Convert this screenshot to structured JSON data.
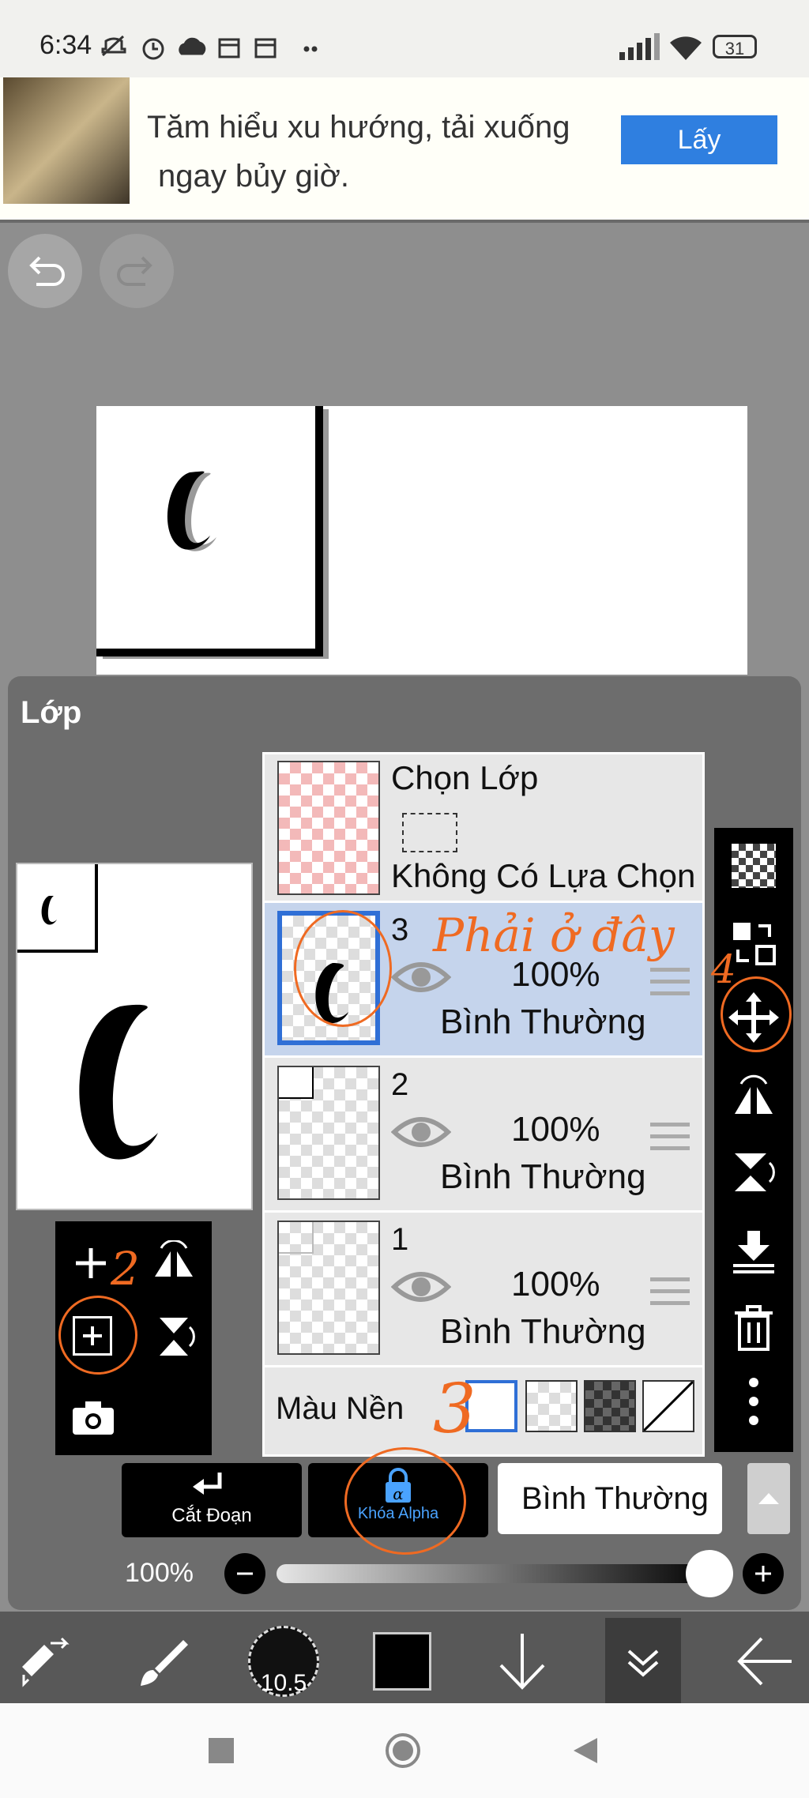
{
  "status_bar": {
    "time": "6:34",
    "battery": "31"
  },
  "ad": {
    "text_line1": "Tăm hiểu xu hướng, tải xuống",
    "text_line2": "ngay bủy giờ.",
    "button_label": "Lấy"
  },
  "layer_panel": {
    "title": "Lớp",
    "selection_layer": {
      "title": "Chọn Lớp",
      "status": "Không Có Lựa Chọn"
    },
    "layers": [
      {
        "number": "3",
        "opacity": "100%",
        "blend_mode": "Bình Thường",
        "selected": true
      },
      {
        "number": "2",
        "opacity": "100%",
        "blend_mode": "Bình Thường",
        "selected": false
      },
      {
        "number": "1",
        "opacity": "100%",
        "blend_mode": "Bình Thường",
        "selected": false
      }
    ],
    "background_label": "Màu Nền"
  },
  "bottom_controls": {
    "clip_label": "Cắt Đoạn",
    "alpha_lock_label": "Khóa Alpha",
    "blend_mode_value": "Bình Thường",
    "opacity_label": "100%"
  },
  "toolbar": {
    "brush_size": "10.5",
    "color": "#000000"
  },
  "annotations": {
    "note": "Phải ở đây",
    "step2": "2",
    "step3": "3",
    "step4": "4"
  },
  "colors": {
    "accent_blue": "#2f7fe0",
    "selected_row": "#c5d4ec",
    "annotation": "#ef6a22"
  }
}
